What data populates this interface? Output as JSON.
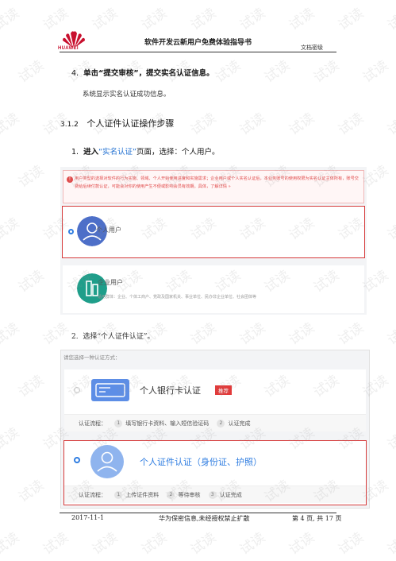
{
  "header": {
    "logo_text": "HUAWEI",
    "title": "软件开发云新用户免费体验指导书",
    "level": "文档密级"
  },
  "step4": {
    "num": "4.",
    "pre": "单击",
    "action": "“提交审核”",
    "post": "，提交实名认证信息。"
  },
  "step4_result": "系统显示实名认证成功信息。",
  "section": {
    "num": "3.1.2",
    "title": "个人证件认证操作步骤"
  },
  "step1": {
    "num": "1.",
    "pre": "进入",
    "link": "“实名认证”",
    "post": "页面，选择：个人用户。"
  },
  "shot1": {
    "notice": "用户类型的选择对软件的行为实施、领域、个人开始使用进度和实施需求；企业用户或个人实名认证后，本业务账号的使用权限为实名认证主体所有，账号交费给后续付款认证，可能会对你的使用产生不便或影响会员有效期。具体，了解详情 »",
    "personal_label": "个人用户",
    "enterprise_label": "企业用户",
    "enterprise_desc": "适用群体：企业、个体工商户、党政及国家机关、事业单位、民办非企业单位、社会团体等"
  },
  "step2": {
    "num": "2.",
    "text": "选择“个人证件认证”。"
  },
  "shot2": {
    "prompt": "请您选择一种认证方式：",
    "bank": {
      "title": "个人银行卡认证",
      "badge": "推荐",
      "flow_label": "认证流程：",
      "steps": [
        "1",
        "填写银行卡资料、输入短信验证码",
        "2",
        "认证完成"
      ]
    },
    "idcard": {
      "title": "个人证件认证（身份证、护照）",
      "flow_label": "认证流程：",
      "steps": [
        "1",
        "上传证件资料",
        "2",
        "等待审核",
        "3",
        "认证完成"
      ]
    }
  },
  "footer": {
    "date": "2017-11-1",
    "notice": "华为保密信息,未经授权禁止扩散",
    "page": "第 4 页, 共 17 页"
  },
  "watermark": "试读",
  "colors": {
    "accent": "#2f7de1",
    "alert": "#e23a3a",
    "brand": "#c8102e"
  }
}
